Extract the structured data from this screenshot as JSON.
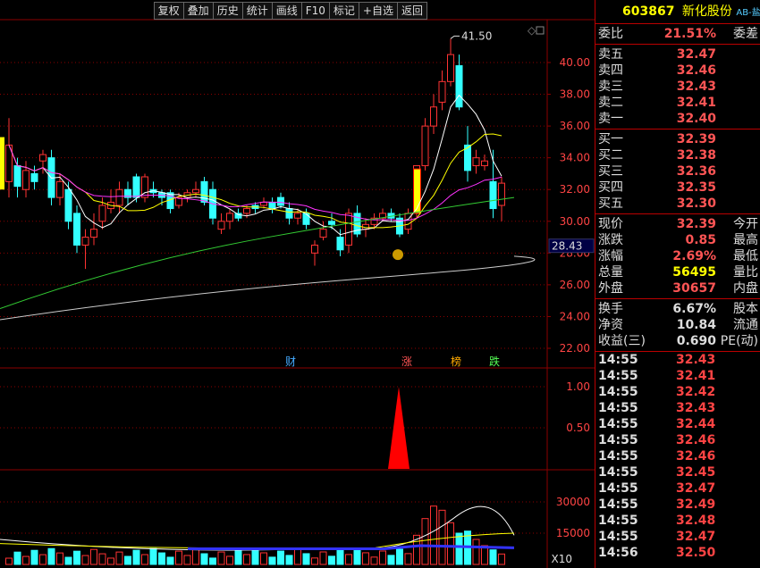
{
  "toolbar": [
    "复权",
    "叠加",
    "历史",
    "统计",
    "画线",
    "F10",
    "标记",
    "+自选",
    "返回"
  ],
  "chart": {
    "price_axis": [
      "40.00",
      "38.00",
      "36.00",
      "34.00",
      "32.00",
      "30.00",
      "28.00",
      "26.00",
      "24.00",
      "22.00"
    ],
    "high_label": "41.50",
    "cursor_price": "28.43",
    "ind_axis": [
      "1.00",
      "0.50"
    ],
    "vol_axis": [
      "30000",
      "15000"
    ],
    "vol_unit": "X10",
    "markers": [
      {
        "text": "财",
        "color": "#4af"
      },
      {
        "text": "涨",
        "color": "#f55"
      },
      {
        "text": "榜",
        "color": "#fa0"
      },
      {
        "text": "跌",
        "color": "#5f5"
      }
    ]
  },
  "panel": {
    "code": "603867",
    "name": "新化股份",
    "sub": "AB-盐湖",
    "weibi": {
      "label": "委比",
      "value": "21.51%",
      "label2": "委差"
    },
    "asks": [
      {
        "label": "卖五",
        "price": "32.47"
      },
      {
        "label": "卖四",
        "price": "32.46"
      },
      {
        "label": "卖三",
        "price": "32.43"
      },
      {
        "label": "卖二",
        "price": "32.41"
      },
      {
        "label": "卖一",
        "price": "32.40"
      }
    ],
    "bids": [
      {
        "label": "买一",
        "price": "32.39"
      },
      {
        "label": "买二",
        "price": "32.38"
      },
      {
        "label": "买三",
        "price": "32.36"
      },
      {
        "label": "买四",
        "price": "32.35"
      },
      {
        "label": "买五",
        "price": "32.30"
      }
    ],
    "quote": [
      {
        "label": "现价",
        "value": "32.39",
        "label2": "今开",
        "color": "red"
      },
      {
        "label": "涨跌",
        "value": "0.85",
        "label2": "最高",
        "color": "red"
      },
      {
        "label": "涨幅",
        "value": "2.69%",
        "label2": "最低",
        "color": "red"
      },
      {
        "label": "总量",
        "value": "56495",
        "label2": "量比",
        "color": "yel"
      },
      {
        "label": "外盘",
        "value": "30657",
        "label2": "内盘",
        "color": "red"
      }
    ],
    "fund": [
      {
        "label": "换手",
        "value": "6.67%",
        "label2": "股本"
      },
      {
        "label": "净资",
        "value": "10.84",
        "label2": "流通"
      },
      {
        "label": "收益(三)",
        "value": "0.690",
        "label2": "PE(动)"
      }
    ],
    "ticks": [
      {
        "time": "14:55",
        "price": "32.43"
      },
      {
        "time": "14:55",
        "price": "32.41"
      },
      {
        "time": "14:55",
        "price": "32.42"
      },
      {
        "time": "14:55",
        "price": "32.43"
      },
      {
        "time": "14:55",
        "price": "32.44"
      },
      {
        "time": "14:55",
        "price": "32.46"
      },
      {
        "time": "14:55",
        "price": "32.46"
      },
      {
        "time": "14:55",
        "price": "32.45"
      },
      {
        "time": "14:55",
        "price": "32.47"
      },
      {
        "time": "14:55",
        "price": "32.49"
      },
      {
        "time": "14:55",
        "price": "32.48"
      },
      {
        "time": "14:55",
        "price": "32.47"
      },
      {
        "time": "14:56",
        "price": "32.50"
      }
    ]
  },
  "colors": {
    "up": "#ff3333",
    "down": "#33ffff",
    "grid": "#8b0000",
    "ma5": "#ffffff",
    "ma10": "#ffff00",
    "ma20": "#ff33ff",
    "ma60": "#33cc33",
    "ma120": "#cccccc"
  }
}
